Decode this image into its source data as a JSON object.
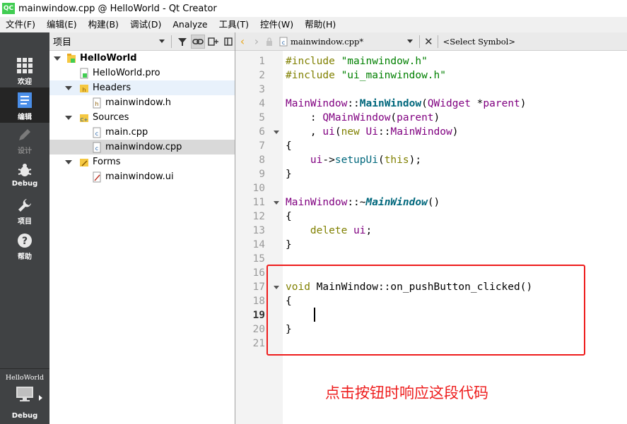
{
  "window": {
    "title": "mainwindow.cpp @ HelloWorld - Qt Creator",
    "logo_text": "QC"
  },
  "menu": [
    "文件(F)",
    "编辑(E)",
    "构建(B)",
    "调试(D)",
    "Analyze",
    "工具(T)",
    "控件(W)",
    "帮助(H)"
  ],
  "modes": [
    {
      "label": "欢迎",
      "icon": "grid-icon"
    },
    {
      "label": "编辑",
      "icon": "document-icon"
    },
    {
      "label": "设计",
      "icon": "pencil-icon"
    },
    {
      "label": "Debug",
      "icon": "bug-icon"
    },
    {
      "label": "项目",
      "icon": "wrench-icon"
    },
    {
      "label": "帮助",
      "icon": "help-icon"
    }
  ],
  "kit": {
    "name": "HelloWorld",
    "build": "Debug"
  },
  "project_panel": {
    "title": "项目",
    "tree": [
      {
        "label": "HelloWorld",
        "level": 0,
        "expanded": true,
        "bold": true,
        "icon": "project-icon"
      },
      {
        "label": "HelloWorld.pro",
        "level": 1,
        "icon": "pro-file-icon"
      },
      {
        "label": "Headers",
        "level": 1,
        "expanded": true,
        "icon": "header-folder-icon"
      },
      {
        "label": "mainwindow.h",
        "level": 2,
        "icon": "header-file-icon"
      },
      {
        "label": "Sources",
        "level": 1,
        "expanded": true,
        "icon": "source-folder-icon"
      },
      {
        "label": "main.cpp",
        "level": 2,
        "icon": "cpp-file-icon"
      },
      {
        "label": "mainwindow.cpp",
        "level": 2,
        "icon": "cpp-file-icon",
        "selected": true
      },
      {
        "label": "Forms",
        "level": 1,
        "expanded": true,
        "icon": "forms-folder-icon"
      },
      {
        "label": "mainwindow.ui",
        "level": 2,
        "icon": "ui-file-icon"
      }
    ]
  },
  "editor": {
    "document": "mainwindow.cpp*",
    "symbol": "<Select Symbol>",
    "current_line": 19,
    "lines": [
      "#include \"mainwindow.h\"",
      "#include \"ui_mainwindow.h\"",
      "",
      "MainWindow::MainWindow(QWidget *parent)",
      "    : QMainWindow(parent)",
      "    , ui(new Ui::MainWindow)",
      "{",
      "    ui->setupUi(this);",
      "}",
      "",
      "MainWindow::~MainWindow()",
      "{",
      "    delete ui;",
      "}",
      "",
      "",
      "void MainWindow::on_pushButton_clicked()",
      "{",
      "",
      "}",
      ""
    ]
  },
  "annotation": "点击按钮时响应这段代码",
  "colors": {
    "annotation": "#ee1c1c",
    "keyword": "#808000",
    "string": "#008000",
    "type": "#800080",
    "function": "#00677c"
  }
}
